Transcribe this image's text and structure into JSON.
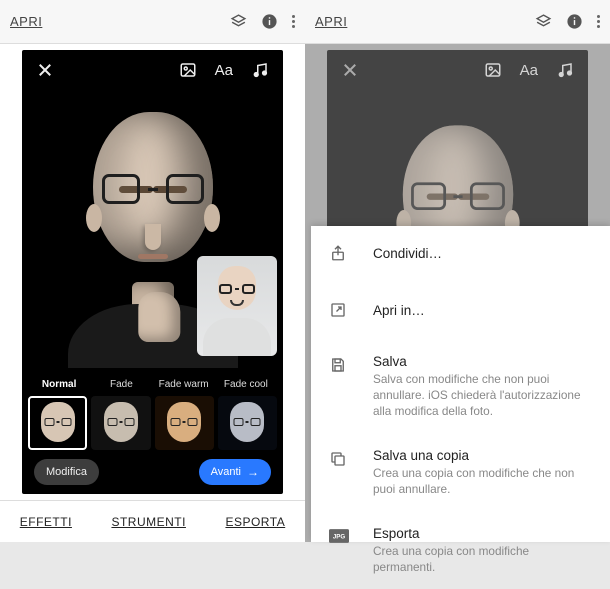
{
  "appbar": {
    "open": "APRI"
  },
  "editor": {
    "filters": [
      {
        "key": "normal",
        "label": "Normal"
      },
      {
        "key": "fade",
        "label": "Fade"
      },
      {
        "key": "fade_warm",
        "label": "Fade warm"
      },
      {
        "key": "fade_cool",
        "label": "Fade cool"
      }
    ],
    "modify": "Modifica",
    "next": "Avanti"
  },
  "footer": {
    "effects": "EFFETTI",
    "tools": "STRUMENTI",
    "export": "ESPORTA"
  },
  "sheet": {
    "share": "Condividi…",
    "open_in": "Apri in…",
    "save": {
      "title": "Salva",
      "desc": "Salva con modifiche che non puoi annullare. iOS chiederà l'autorizzazione alla modifica della foto."
    },
    "save_copy": {
      "title": "Salva una copia",
      "desc": "Crea una copia con modifiche che non puoi annullare."
    },
    "export": {
      "title": "Esporta",
      "desc": "Crea una copia con modifiche permanenti."
    }
  }
}
